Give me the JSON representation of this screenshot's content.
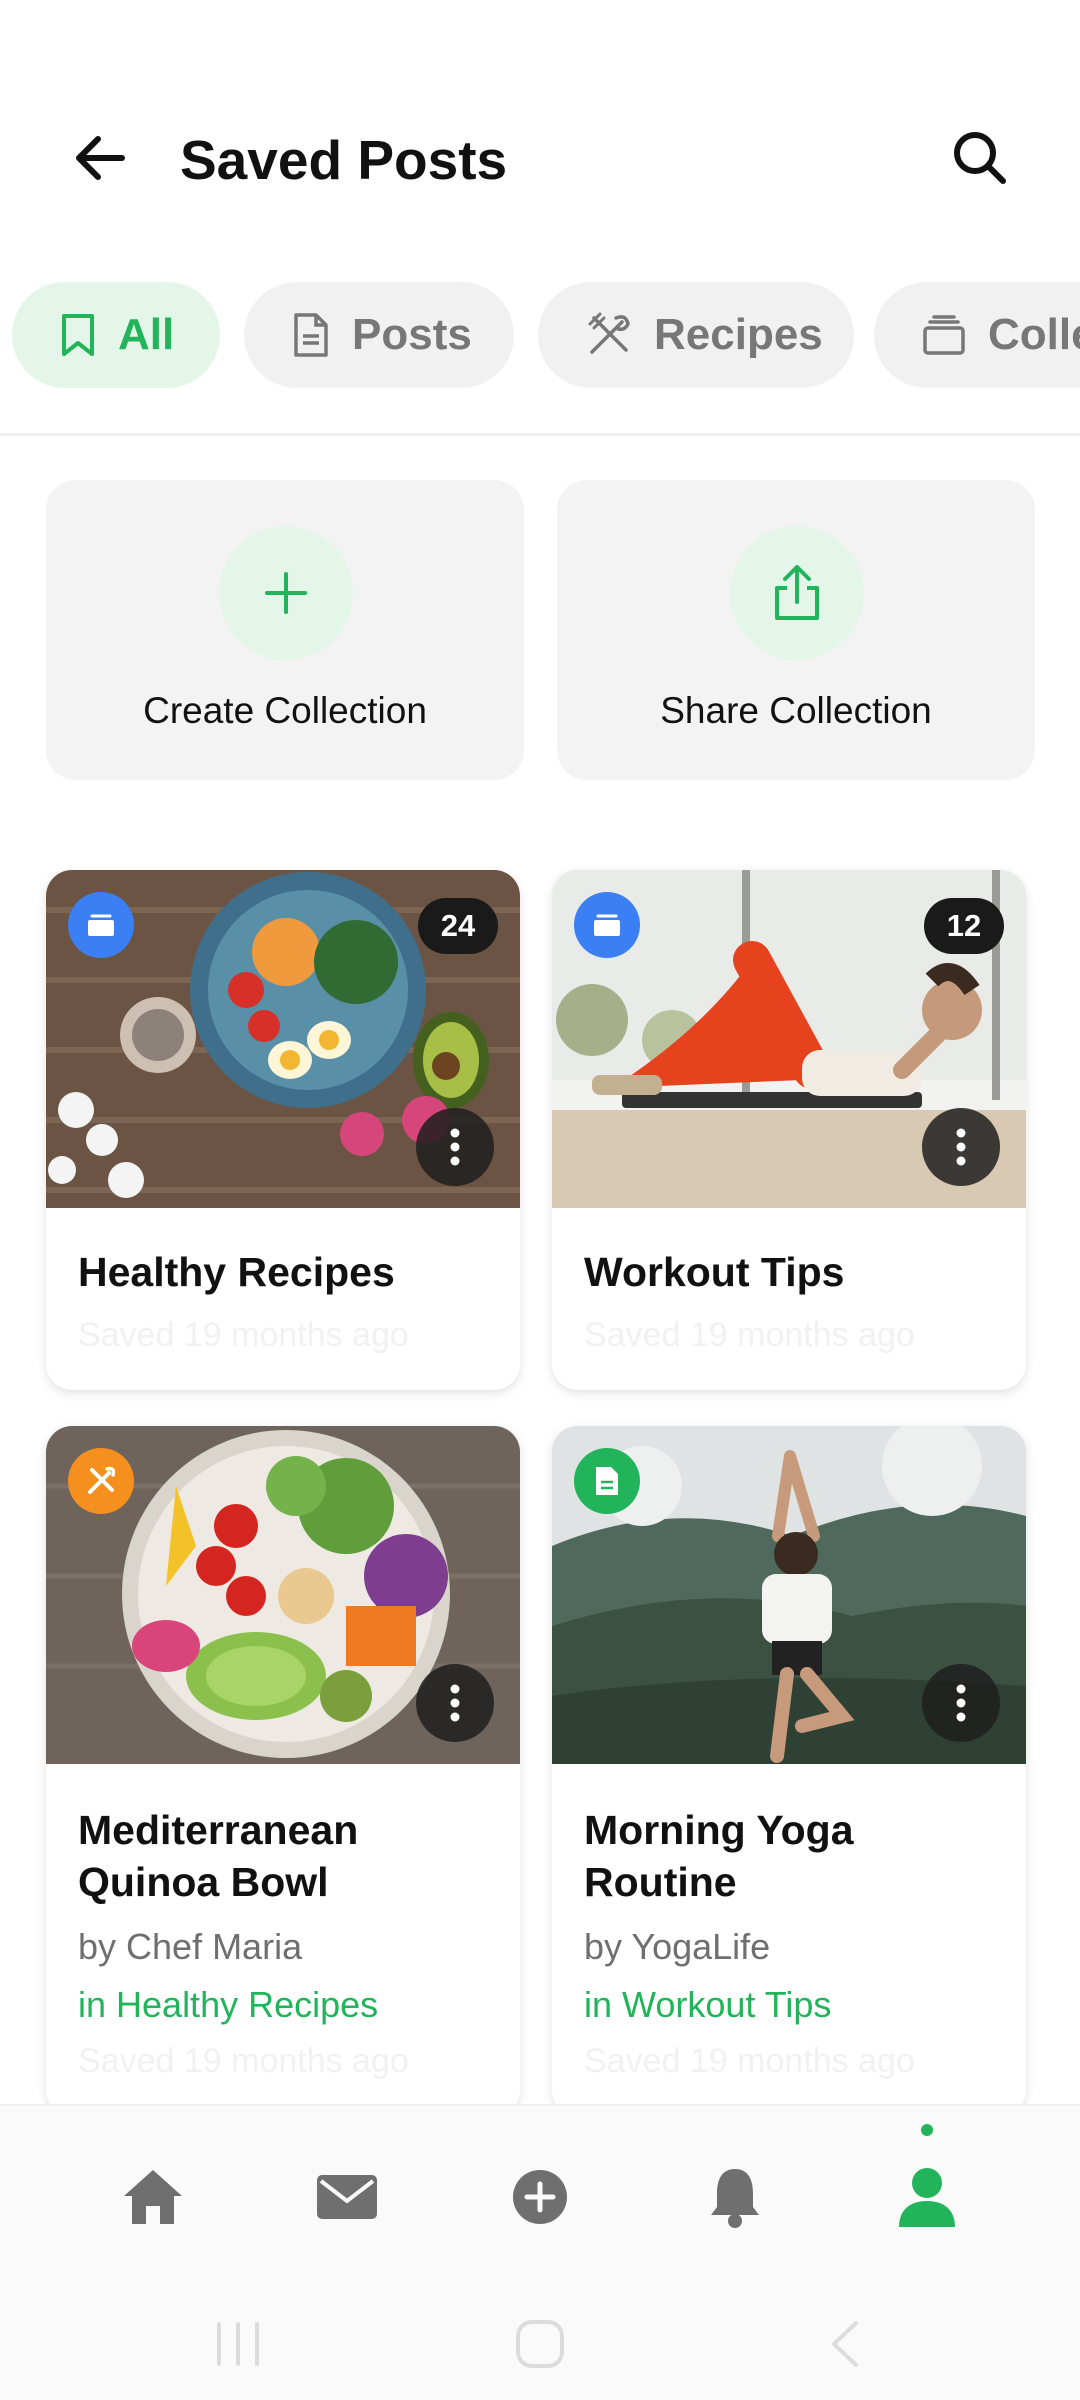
{
  "header": {
    "title": "Saved Posts",
    "back_icon": "arrow-left-icon",
    "search_icon": "search-icon"
  },
  "filters": [
    {
      "label": "All",
      "icon": "bookmark-icon",
      "active": true
    },
    {
      "label": "Posts",
      "icon": "document-icon",
      "active": false
    },
    {
      "label": "Recipes",
      "icon": "utensils-icon",
      "active": false
    },
    {
      "label": "Colle",
      "icon": "collection-icon",
      "active": false
    }
  ],
  "actions": [
    {
      "label": "Create Collection",
      "icon": "plus-icon"
    },
    {
      "label": "Share Collection",
      "icon": "share-icon"
    }
  ],
  "cards": [
    {
      "title": "Healthy Recipes",
      "saved": "Saved 19 months ago",
      "count": "24",
      "type": "collection",
      "badge_color": "#3b7ff5"
    },
    {
      "title": "Workout Tips",
      "saved": "Saved 19 months ago",
      "count": "12",
      "type": "collection",
      "badge_color": "#3b7ff5"
    },
    {
      "title_lines": [
        "Mediterranean",
        "Quinoa Bowl"
      ],
      "author": "by Chef Maria",
      "collection": "in Healthy Recipes",
      "saved": "Saved 19 months ago",
      "type": "recipe",
      "badge_color": "#f5901e"
    },
    {
      "title_lines": [
        "Morning Yoga",
        "Routine"
      ],
      "author": "by YogaLife",
      "collection": "in Workout Tips",
      "saved": "Saved 19 months ago",
      "type": "post",
      "badge_color": "#22b45a"
    }
  ],
  "bottom_nav": [
    {
      "icon": "home-icon",
      "active": false
    },
    {
      "icon": "mail-icon",
      "active": false
    },
    {
      "icon": "add-circle-icon",
      "active": false
    },
    {
      "icon": "bell-icon",
      "active": false
    },
    {
      "icon": "profile-icon",
      "active": true
    }
  ],
  "colors": {
    "accent": "#22b45a",
    "accent_light": "#e3f6e9",
    "chip_bg": "#f1f1f1",
    "text_muted": "#6f6f6f"
  }
}
